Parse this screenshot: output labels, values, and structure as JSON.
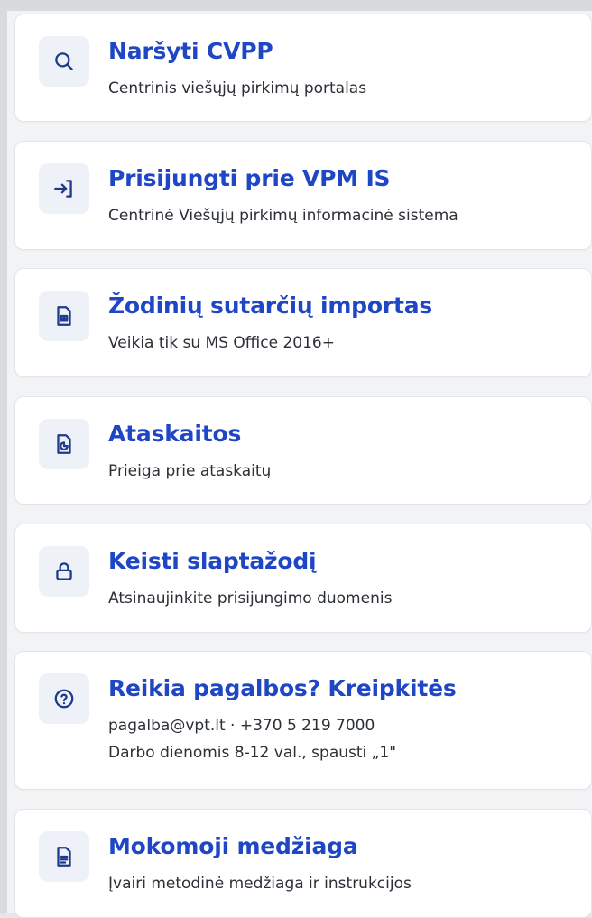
{
  "cards": [
    {
      "icon": "search-icon",
      "title": "Naršyti CVPP",
      "lines": [
        "Centrinis viešųjų pirkimų portalas"
      ]
    },
    {
      "icon": "login-arrow-icon",
      "title": "Prisijungti prie VPM IS",
      "lines": [
        "Centrinė Viešųjų pirkimų informacinė sistema"
      ]
    },
    {
      "icon": "spreadsheet-file-icon",
      "title": "Žodinių sutarčių importas",
      "lines": [
        "Veikia tik su MS Office 2016+"
      ]
    },
    {
      "icon": "report-icon",
      "title": "Ataskaitos",
      "lines": [
        "Prieiga prie ataskaitų"
      ]
    },
    {
      "icon": "lock-icon",
      "title": "Keisti slaptažodį",
      "lines": [
        "Atsinaujinkite prisijungimo duomenis"
      ]
    },
    {
      "icon": "help-icon",
      "title": "Reikia pagalbos? Kreipkitės",
      "lines": [
        "pagalba@vpt.lt · +370 5 219 7000",
        "Darbo dienomis 8-12 val., spausti „1\""
      ]
    },
    {
      "icon": "document-icon",
      "title": "Mokomoji medžiaga",
      "lines": [
        "Įvairi metodinė medžiaga ir instrukcijos"
      ]
    }
  ],
  "colors": {
    "title": "#1f46c4",
    "icon": "#1e3a8a",
    "icon_bg": "#eef2f8",
    "card_bg": "#ffffff",
    "page_bg": "#f2f3f5"
  }
}
